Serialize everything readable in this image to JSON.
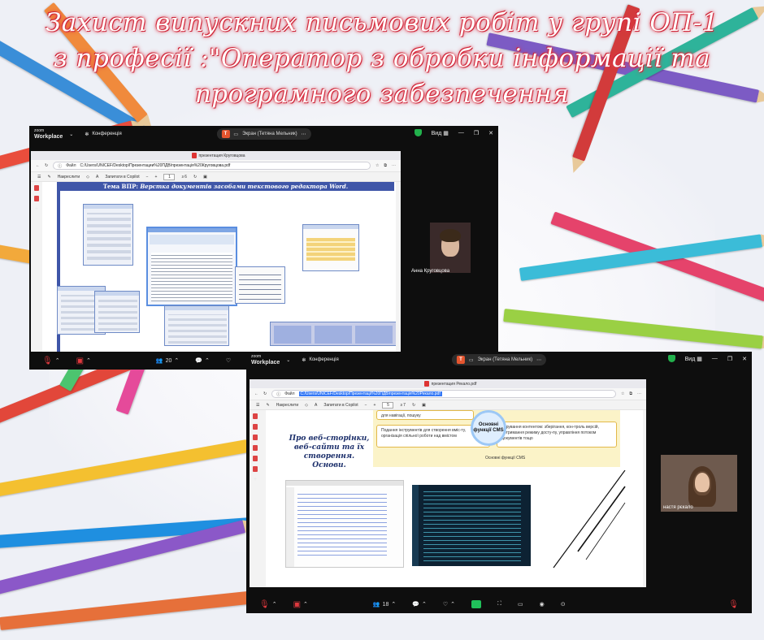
{
  "title": {
    "line1": "Захист  випускних  письмових робіт у групі ОП-1",
    "line2": "з професії :\"Оператор з обробки інформації та",
    "line3": "програмного забезпечення"
  },
  "zoom_window_1": {
    "logo": "zoom",
    "logo_sub": "Workplace",
    "conference_label": "Конференція",
    "share_pill_badge": "T",
    "share_pill_label": "Экран (Тетяна Мельник)",
    "view_label": "Вид",
    "participant_name": "Анна Круговцова",
    "participants_count": "20",
    "browser": {
      "tab_title": "презентация Круговцова",
      "file_label": "Файл",
      "url": "C:/Users/UNICEF/Desktop/Презентации%20ПДВ/презентація%20Круговцова.pdf",
      "draw_label": "Накреслити",
      "copilot_label": "Запитати в Copilot",
      "page_current": "1",
      "page_total": "з 6"
    },
    "slide_heading_prefix": "Тема ВПР:",
    "slide_heading_italic": "Верстка документів засобами текстового редактора Word."
  },
  "zoom_window_2": {
    "logo": "zoom",
    "logo_sub": "Workplace",
    "conference_label": "Конференція",
    "share_pill_badge": "T",
    "share_pill_label": "Экран (Тетяна Мельник)",
    "view_label": "Вид",
    "participant_name": "настя рєкало",
    "participants_count": "18",
    "browser": {
      "tab_title": "презентация Рекало.pdf",
      "file_label": "Файл",
      "url": "C:/Users/UNICEF/Desktop/Презентації%20ПДВ/презентація%20Рекало.pdf",
      "draw_label": "Накреслити",
      "copilot_label": "Запитати в Copilot",
      "page_current": "5",
      "page_total": "з 7"
    },
    "slide": {
      "top_text": "для навігації, пошуку",
      "circle_text": "Основні функції CMS",
      "right_text": "Керування контентом: зберігання, кон-троль версій, дотримання режиму досту-пу, управління потоком документів тощо",
      "left_text": "Подання інструментів для створення вміс-ту, організація спільної роботи над вмістом",
      "caption": "Основні функції CMS",
      "italic_heading": "Про веб-сторінки, веб-сайти та їх створення. Основи."
    }
  },
  "colors": {
    "title_glow": "#e03a4a",
    "zoom_bg": "#0e0e0e",
    "slide_blue": "#3f56a8",
    "cms_yellow": "#fbf3c8",
    "highlight": "#3478f6"
  }
}
